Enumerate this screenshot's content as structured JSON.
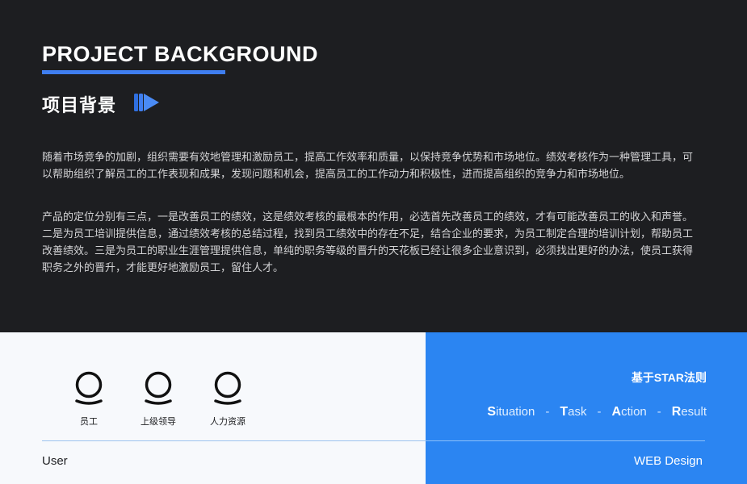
{
  "header": {
    "title_en": "PROJECT BACKGROUND",
    "title_cn": "项目背景",
    "accent_color": "#3f7ef0",
    "icon": "play-forward-icon"
  },
  "paragraphs": [
    "随着市场竞争的加剧，组织需要有效地管理和激励员工，提高工作效率和质量，以保持竞争优势和市场地位。绩效考核作为一种管理工具，可以帮助组织了解员工的工作表现和成果，发现问题和机会，提高员工的工作动力和积极性，进而提高组织的竞争力和市场地位。",
    "产品的定位分别有三点，一是改善员工的绩效，这是绩效考核的最根本的作用，必选首先改善员工的绩效，才有可能改善员工的收入和声誉。二是为员工培训提供信息，通过绩效考核的总结过程，找到员工绩效中的存在不足，结合企业的要求，为员工制定合理的培训计划，帮助员工改善绩效。三是为员工的职业生涯管理提供信息，单纯的职务等级的晋升的天花板已经让很多企业意识到，必须找出更好的办法，使员工获得职务之外的晋升，才能更好地激励员工，留住人才。"
  ],
  "users": {
    "roles": [
      {
        "label": "员工",
        "icon": "user-icon"
      },
      {
        "label": "上级领导",
        "icon": "user-icon"
      },
      {
        "label": "人力资源",
        "icon": "user-icon"
      }
    ],
    "section_label": "User"
  },
  "star": {
    "title": "基于STAR法则",
    "items": [
      {
        "initial": "S",
        "rest": "ituation"
      },
      {
        "initial": "T",
        "rest": "ask"
      },
      {
        "initial": "A",
        "rest": "ction"
      },
      {
        "initial": "R",
        "rest": "esult"
      }
    ],
    "separator": "-",
    "footer": "WEB Design",
    "panel_color": "#2b85f2"
  }
}
